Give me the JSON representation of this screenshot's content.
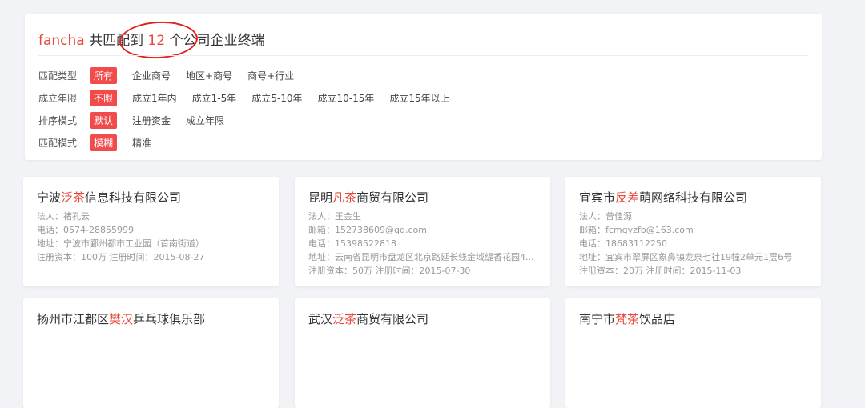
{
  "header": {
    "keyword": "fancha",
    "prefix": " 共匹配到 ",
    "count": "12",
    "suffix": " 个公司企业终端"
  },
  "filters": [
    {
      "label": "匹配类型",
      "options": [
        "所有",
        "企业商号",
        "地区+商号",
        "商号+行业"
      ],
      "active": 0
    },
    {
      "label": "成立年限",
      "options": [
        "不限",
        "成立1年内",
        "成立1-5年",
        "成立5-10年",
        "成立10-15年",
        "成立15年以上"
      ],
      "active": 0
    },
    {
      "label": "排序模式",
      "options": [
        "默认",
        "注册资金",
        "成立年限"
      ],
      "active": 0
    },
    {
      "label": "匹配模式",
      "options": [
        "模糊",
        "精准"
      ],
      "active": 0
    }
  ],
  "cards": [
    {
      "name_pre": "宁波",
      "name_hl": "泛茶",
      "name_post": "信息科技有限公司",
      "lines": [
        "法人：褚孔云",
        "电话：0574-28855999",
        "地址：宁波市鄞州都市工业园（首南街道）",
        "注册资本：100万    注册时间：2015-08-27"
      ]
    },
    {
      "name_pre": "昆明",
      "name_hl": "凡茶",
      "name_post": "商贸有限公司",
      "lines": [
        "法人：王金生",
        "邮箱：152738609@qq.com",
        "电话：15398522818",
        "地址：云南省昆明市盘龙区北京路延长线金域缇香花园4...",
        "注册资本：50万    注册时间：2015-07-30"
      ]
    },
    {
      "name_pre": "宜宾市",
      "name_hl": "反差",
      "name_post": "萌网络科技有限公司",
      "lines": [
        "法人：曾佳源",
        "邮箱：fcmqyzfb@163.com",
        "电话：18683112250",
        "地址：宜宾市翠屏区象鼻镇龙泉七社19幢2单元1层6号",
        "注册资本：20万    注册时间：2015-11-03"
      ]
    },
    {
      "name_pre": "扬州市江都区",
      "name_hl": "樊汉",
      "name_post": "乒乓球俱乐部",
      "lines": []
    },
    {
      "name_pre": "武汉",
      "name_hl": "泛茶",
      "name_post": "商贸有限公司",
      "lines": []
    },
    {
      "name_pre": "南宁市",
      "name_hl": "梵茶",
      "name_post": "饮品店",
      "lines": []
    }
  ]
}
